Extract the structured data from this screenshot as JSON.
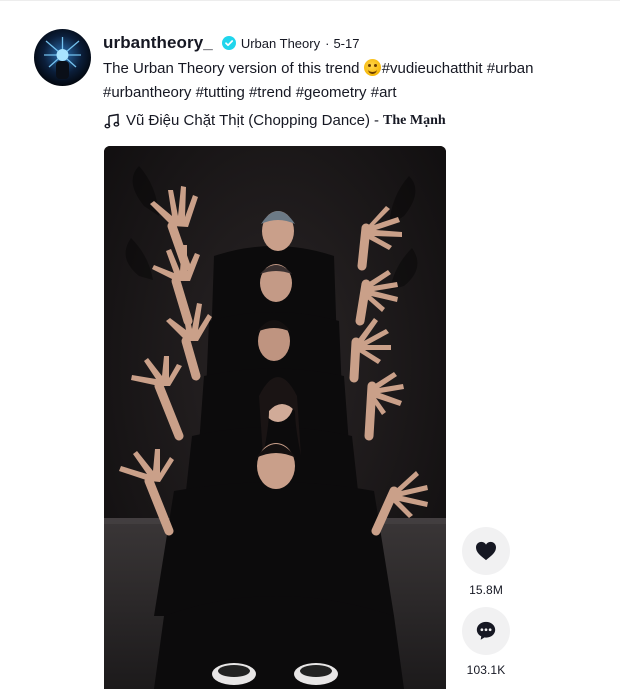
{
  "post": {
    "username": "urbantheory_",
    "nickname": "Urban Theory",
    "separator": "·",
    "date": "5-17",
    "caption_text": "The Urban Theory version of this trend ",
    "hashtags": [
      "#vudieuchatthit",
      "#urban",
      "#urbantheory",
      "#tutting",
      "#trend",
      "#geometry",
      "#art"
    ],
    "music_title": "Vũ Điệu Chặt Thịt (Chopping Dance)",
    "music_separator": "-",
    "music_author": "The Mạnh"
  },
  "actions": {
    "likes": "15.8M",
    "comments": "103.1K"
  },
  "icons": {
    "verified": "verified-badge-icon",
    "emoji": "grinning-emoji-icon",
    "music": "music-note-icon",
    "like": "heart-icon",
    "comment": "comment-bubble-icon"
  },
  "colors": {
    "verified": "#20d5ec",
    "text": "#161823",
    "action_bg": "#f1f1f2",
    "video_bg": "#1a1718"
  }
}
